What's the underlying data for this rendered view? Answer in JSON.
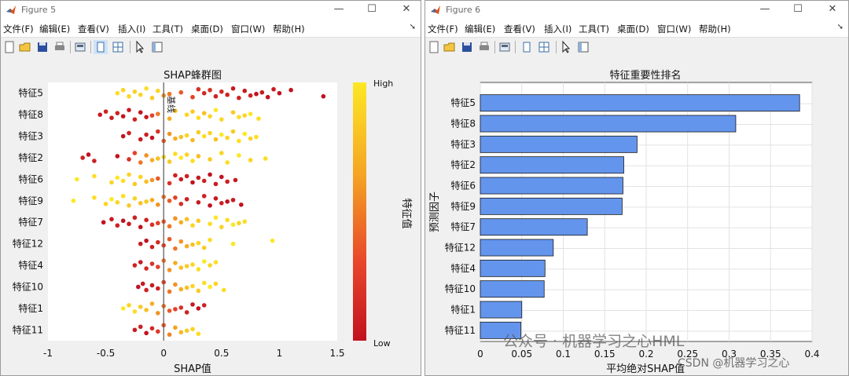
{
  "window1": {
    "title": "Figure 5",
    "menu": [
      "文件(F)",
      "编辑(E)",
      "查看(V)",
      "插入(I)",
      "工具(T)",
      "桌面(D)",
      "窗口(W)",
      "帮助(H)"
    ],
    "toolbar_icons": [
      "new-figure-icon",
      "open-file-icon",
      "save-icon",
      "print-icon",
      "link-icon",
      "dock-icon",
      "property-editor-icon",
      "pointer-icon",
      "data-tips-icon"
    ]
  },
  "window2": {
    "title": "Figure 6",
    "menu": [
      "文件(F)",
      "编辑(E)",
      "查看(V)",
      "插入(I)",
      "工具(T)",
      "桌面(D)",
      "窗口(W)",
      "帮助(H)"
    ],
    "toolbar_icons": [
      "new-figure-icon",
      "open-file-icon",
      "save-icon",
      "print-icon",
      "link-icon",
      "dock-icon",
      "property-editor-icon",
      "pointer-icon",
      "data-tips-icon"
    ]
  },
  "window_controls": {
    "minimize": "—",
    "maximize": "☐",
    "close": "✕"
  },
  "chart_data": [
    {
      "type": "scatter",
      "title": "SHAP蜂群图",
      "xlabel": "SHAP值",
      "xlim": [
        -1,
        1.5
      ],
      "xticks": [
        "-1",
        "-0.5",
        "0",
        "0.5",
        "1",
        "1.5"
      ],
      "baseline_label": "基线",
      "features": [
        "特征5",
        "特征8",
        "特征3",
        "特征2",
        "特征6",
        "特征9",
        "特征7",
        "特征12",
        "特征4",
        "特征10",
        "特征1",
        "特征11"
      ],
      "colorbar": {
        "label": "特征值",
        "high": "High",
        "low": "Low",
        "colors": [
          "#fde725",
          "#f5a623",
          "#e8452a",
          "#c1121f"
        ]
      },
      "series": [
        {
          "feature": "特征5",
          "values": [
            -0.4,
            -0.35,
            -0.3,
            -0.25,
            -0.2,
            -0.15,
            -0.1,
            -0.05,
            0.0,
            0.05,
            0.15,
            0.25,
            0.3,
            0.35,
            0.4,
            0.45,
            0.5,
            0.55,
            0.6,
            0.65,
            0.7,
            0.75,
            0.8,
            0.85,
            0.9,
            0.95,
            1.0,
            1.1,
            1.38
          ],
          "heats": [
            0.95,
            0.9,
            0.92,
            0.88,
            0.9,
            0.95,
            0.85,
            0.9,
            0.6,
            0.5,
            0.4,
            0.3,
            0.2,
            0.15,
            0.2,
            0.1,
            0.15,
            0.1,
            0.05,
            0.1,
            0.05,
            0.1,
            0.0,
            0.05,
            0.0,
            0.05,
            0.0,
            0.0,
            0.0
          ]
        },
        {
          "feature": "特征8",
          "values": [
            -0.55,
            -0.5,
            -0.45,
            -0.4,
            -0.35,
            -0.3,
            -0.25,
            -0.2,
            -0.15,
            -0.1,
            -0.05,
            0.05,
            0.1,
            0.2,
            0.25,
            0.3,
            0.35,
            0.4,
            0.45,
            0.5,
            0.6,
            0.65,
            0.7,
            0.75,
            0.82
          ],
          "heats": [
            0.05,
            0.1,
            0.05,
            0.1,
            0.0,
            0.05,
            0.1,
            0.0,
            0.05,
            0.3,
            0.5,
            0.7,
            0.8,
            0.9,
            0.85,
            0.95,
            0.8,
            0.9,
            1.0,
            0.9,
            0.85,
            0.95,
            0.9,
            1.0,
            0.95
          ]
        },
        {
          "feature": "特征3",
          "values": [
            -0.35,
            -0.3,
            -0.2,
            -0.15,
            -0.1,
            -0.05,
            0.0,
            0.05,
            0.1,
            0.15,
            0.2,
            0.25,
            0.3,
            0.35,
            0.4,
            0.45,
            0.5,
            0.55,
            0.6,
            0.65,
            0.7,
            0.75,
            0.8
          ],
          "heats": [
            0.0,
            0.1,
            0.05,
            0.1,
            0.0,
            0.2,
            0.4,
            0.6,
            0.7,
            0.8,
            0.9,
            0.75,
            0.85,
            0.95,
            0.9,
            0.8,
            1.0,
            0.9,
            0.85,
            0.95,
            1.0,
            0.9,
            0.95
          ]
        },
        {
          "feature": "特征2",
          "values": [
            -0.7,
            -0.65,
            -0.6,
            -0.4,
            -0.3,
            -0.25,
            -0.2,
            -0.15,
            -0.1,
            -0.05,
            0.0,
            0.05,
            0.1,
            0.15,
            0.2,
            0.25,
            0.3,
            0.4,
            0.5,
            0.55,
            0.65,
            0.75,
            0.88
          ],
          "heats": [
            0.1,
            0.0,
            0.1,
            0.0,
            0.2,
            0.3,
            0.5,
            0.6,
            0.7,
            0.8,
            0.9,
            0.85,
            0.95,
            1.0,
            0.9,
            0.95,
            0.8,
            0.85,
            0.9,
            0.95,
            1.0,
            0.9,
            0.95
          ]
        },
        {
          "feature": "特征6",
          "values": [
            -0.75,
            -0.6,
            -0.45,
            -0.4,
            -0.35,
            -0.3,
            -0.25,
            -0.2,
            -0.15,
            -0.1,
            -0.05,
            0.05,
            0.1,
            0.15,
            0.2,
            0.25,
            0.3,
            0.35,
            0.4,
            0.45,
            0.5,
            0.55,
            0.62
          ],
          "heats": [
            1.0,
            0.95,
            0.9,
            1.0,
            0.95,
            0.9,
            0.85,
            0.9,
            0.8,
            0.6,
            0.4,
            0.2,
            0.1,
            0.05,
            0.1,
            0.0,
            0.05,
            0.1,
            0.0,
            0.05,
            0.0,
            0.1,
            0.05
          ]
        },
        {
          "feature": "特征9",
          "values": [
            -0.78,
            -0.6,
            -0.5,
            -0.45,
            -0.4,
            -0.35,
            -0.3,
            -0.25,
            -0.2,
            -0.15,
            -0.1,
            -0.05,
            0.0,
            0.05,
            0.1,
            0.15,
            0.2,
            0.3,
            0.35,
            0.4,
            0.45,
            0.5,
            0.55,
            0.6,
            0.67
          ],
          "heats": [
            1.0,
            0.95,
            0.9,
            1.0,
            0.9,
            0.95,
            0.85,
            0.9,
            0.8,
            0.85,
            0.7,
            0.6,
            0.5,
            0.4,
            0.3,
            0.2,
            0.1,
            0.05,
            0.1,
            0.0,
            0.05,
            0.1,
            0.0,
            0.05,
            0.0
          ]
        },
        {
          "feature": "特征7",
          "values": [
            -0.52,
            -0.45,
            -0.4,
            -0.35,
            -0.3,
            -0.25,
            -0.2,
            -0.15,
            -0.1,
            -0.05,
            0.0,
            0.05,
            0.1,
            0.15,
            0.2,
            0.25,
            0.3,
            0.4,
            0.45,
            0.5,
            0.55,
            0.6,
            0.65,
            0.7
          ],
          "heats": [
            0.0,
            0.05,
            0.1,
            0.0,
            0.05,
            0.1,
            0.0,
            0.1,
            0.2,
            0.3,
            0.4,
            0.5,
            0.6,
            0.7,
            0.8,
            0.9,
            0.85,
            0.95,
            1.0,
            0.9,
            0.95,
            1.0,
            0.9,
            0.95
          ]
        },
        {
          "feature": "特征12",
          "values": [
            -0.2,
            -0.15,
            -0.1,
            -0.05,
            0.0,
            0.05,
            0.1,
            0.15,
            0.2,
            0.25,
            0.3,
            0.35,
            0.4,
            0.6,
            0.94
          ],
          "heats": [
            0.05,
            0.0,
            0.1,
            0.15,
            0.3,
            0.4,
            0.5,
            0.6,
            0.7,
            0.8,
            0.9,
            0.85,
            0.95,
            1.0,
            1.0
          ]
        },
        {
          "feature": "特征4",
          "values": [
            -0.25,
            -0.2,
            -0.15,
            -0.1,
            -0.05,
            0.0,
            0.05,
            0.1,
            0.15,
            0.2,
            0.25,
            0.3,
            0.35,
            0.4,
            0.45
          ],
          "heats": [
            0.1,
            0.05,
            0.15,
            0.2,
            0.3,
            0.5,
            0.6,
            0.7,
            0.8,
            0.85,
            0.9,
            0.95,
            1.0,
            0.9,
            0.95
          ]
        },
        {
          "feature": "特征10",
          "values": [
            -0.22,
            -0.18,
            -0.15,
            -0.1,
            -0.05,
            0.0,
            0.05,
            0.1,
            0.15,
            0.2,
            0.25,
            0.3,
            0.35,
            0.4,
            0.45,
            0.52
          ],
          "heats": [
            0.0,
            0.05,
            0.1,
            0.05,
            0.1,
            0.3,
            0.5,
            0.6,
            0.7,
            0.8,
            0.9,
            0.85,
            0.95,
            1.0,
            0.9,
            0.95
          ]
        },
        {
          "feature": "特征1",
          "values": [
            -0.35,
            -0.3,
            -0.25,
            -0.2,
            -0.15,
            -0.1,
            -0.05,
            0.0,
            0.05,
            0.1,
            0.15,
            0.2,
            0.25,
            0.3,
            0.35
          ],
          "heats": [
            1.0,
            0.9,
            0.95,
            0.85,
            0.8,
            0.7,
            0.6,
            0.5,
            0.4,
            0.3,
            0.2,
            0.1,
            0.05,
            0.0,
            0.1
          ]
        },
        {
          "feature": "特征11",
          "values": [
            -0.25,
            -0.2,
            -0.15,
            -0.1,
            -0.05,
            0.0,
            0.05,
            0.1,
            0.15,
            0.2,
            0.25,
            0.3
          ],
          "heats": [
            0.05,
            0.1,
            0.0,
            0.15,
            0.25,
            0.4,
            0.55,
            0.65,
            0.75,
            0.85,
            0.9,
            0.95
          ]
        }
      ]
    },
    {
      "type": "bar",
      "orientation": "horizontal",
      "title": "特征重要性排名",
      "xlabel": "平均绝对SHAP值",
      "ylabel": "预测因子",
      "xlim": [
        0,
        0.4
      ],
      "xticks": [
        "0",
        "0.05",
        "0.1",
        "0.15",
        "0.2",
        "0.25",
        "0.3",
        "0.35",
        "0.4"
      ],
      "categories": [
        "特征5",
        "特征8",
        "特征3",
        "特征2",
        "特征6",
        "特征9",
        "特征7",
        "特征12",
        "特征4",
        "特征10",
        "特征1",
        "特征11"
      ],
      "values": [
        0.385,
        0.308,
        0.189,
        0.173,
        0.172,
        0.171,
        0.129,
        0.088,
        0.078,
        0.077,
        0.05,
        0.049
      ],
      "bar_color": "#6495ed",
      "grid": true
    }
  ],
  "watermark": "公众号 · 机器学习之心HML",
  "credit": "CSDN @机器学习之心"
}
